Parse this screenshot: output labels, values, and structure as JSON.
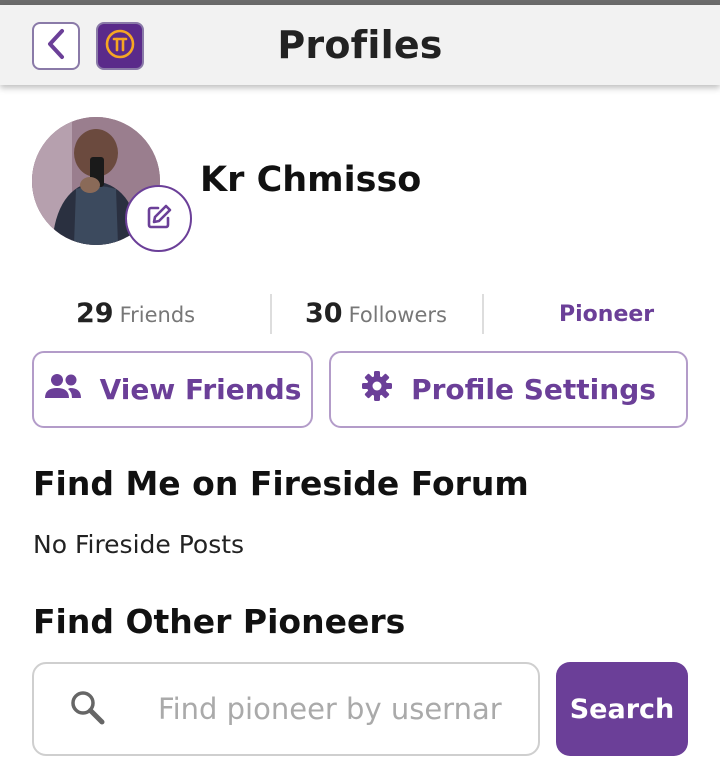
{
  "header": {
    "title": "Profiles",
    "back_icon": "chevron-left-icon",
    "app_icon": "pi-logo-icon"
  },
  "profile": {
    "username": "Kr Chmisso",
    "edit_icon": "edit-icon"
  },
  "stats": {
    "friends_count": "29",
    "friends_label": "Friends",
    "followers_count": "30",
    "followers_label": "Followers",
    "role": "Pioneer"
  },
  "actions": {
    "view_friends_label": "View Friends",
    "view_friends_icon": "people-icon",
    "profile_settings_label": "Profile Settings",
    "profile_settings_icon": "gear-icon"
  },
  "fireside": {
    "title": "Find Me on Fireside Forum",
    "empty_text": "No Fireside Posts"
  },
  "find_pioneers": {
    "title": "Find Other Pioneers",
    "placeholder": "Find pioneer by usernar",
    "search_icon": "search-icon",
    "search_button_label": "Search"
  },
  "colors": {
    "accent": "#6b3f98",
    "header_bg": "#f2f2f2",
    "border": "#b39cc9"
  }
}
